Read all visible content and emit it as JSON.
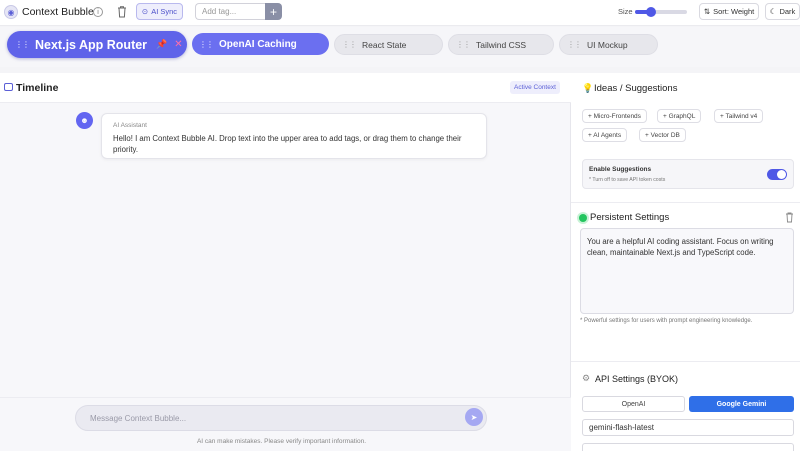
{
  "app": {
    "title": "Context Bubble",
    "logo_icon": "brain-icon",
    "ai_sync_label": "AI Sync",
    "tag_placeholder": "Add tag...",
    "add_symbol": "+",
    "size_label": "Size",
    "size_value": 0.3,
    "sort_label": "Sort: Weight",
    "theme_label": "Dark"
  },
  "bubbles": [
    {
      "label": "Next.js App Router",
      "state": "pinned"
    },
    {
      "label": "OpenAI Caching",
      "state": "active"
    },
    {
      "label": "React State",
      "state": "normal"
    },
    {
      "label": "Tailwind CSS",
      "state": "normal"
    },
    {
      "label": "UI Mockup",
      "state": "normal"
    }
  ],
  "timeline": {
    "title": "Timeline",
    "badge": "Active Context",
    "messages": [
      {
        "sender": "AI Assistant",
        "text": "Hello! I am Context Bubble AI. Drop text into the upper area to add tags, or drag them to change their priority."
      }
    ],
    "composer_placeholder": "Message Context Bubble...",
    "disclaimer": "AI can make mistakes. Please verify important information."
  },
  "ideas": {
    "title": "Ideas / Suggestions",
    "chips": [
      "+ Micro-Frontends",
      "+ GraphQL",
      "+ Tailwind v4",
      "+ AI Agents",
      "+ Vector DB"
    ],
    "enable_title": "Enable Suggestions",
    "enable_subtitle": "* Turn off to save API token costs",
    "enabled": true
  },
  "persistent": {
    "title": "Persistent Settings",
    "prompt": "You are a helpful AI coding assistant. Focus on writing clean, maintainable Next.js and TypeScript code.",
    "note": "* Powerful settings for users with prompt engineering knowledge."
  },
  "api": {
    "title": "API Settings (BYOK)",
    "providers": [
      "OpenAI",
      "Google Gemini"
    ],
    "selected_provider": "Google Gemini",
    "model": "gemini-flash-latest"
  },
  "colors": {
    "accent": "#5f63e9",
    "gemini": "#2f6fe8",
    "online": "#22c55e"
  }
}
